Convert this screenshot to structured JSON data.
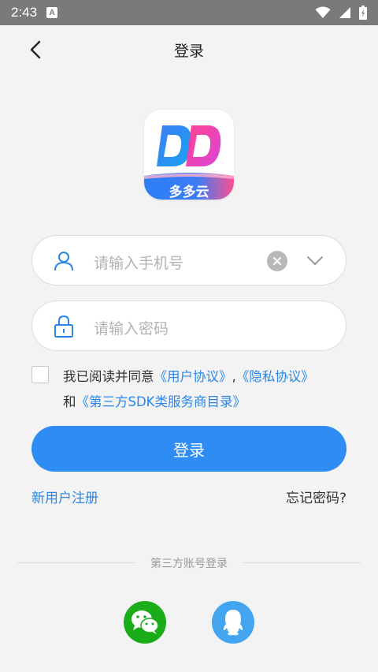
{
  "status_bar": {
    "time": "2:43",
    "notification_badge": "A"
  },
  "header": {
    "title": "登录"
  },
  "app_logo": {
    "letters": "DD",
    "name": "多多云"
  },
  "phone_field": {
    "placeholder": "请输入手机号"
  },
  "password_field": {
    "placeholder": "请输入密码"
  },
  "agreement": {
    "prefix": "我已阅读并同意",
    "user_agreement": "《用户协议》",
    "comma": ",",
    "privacy_agreement": "《隐私协议》",
    "and": "和",
    "sdk_list": "《第三方SDK类服务商目录》"
  },
  "login_button": {
    "label": "登录"
  },
  "links": {
    "register": "新用户注册",
    "forgot_password": "忘记密码?"
  },
  "third_party": {
    "label": "第三方账号登录",
    "providers": [
      "wechat",
      "qq"
    ]
  },
  "colors": {
    "primary": "#2f8cf2",
    "link": "#2a87e8",
    "wechat": "#1aad19",
    "qq": "#43a4f0",
    "status_bar": "#7a7a7a",
    "background": "#f3f3f3"
  }
}
